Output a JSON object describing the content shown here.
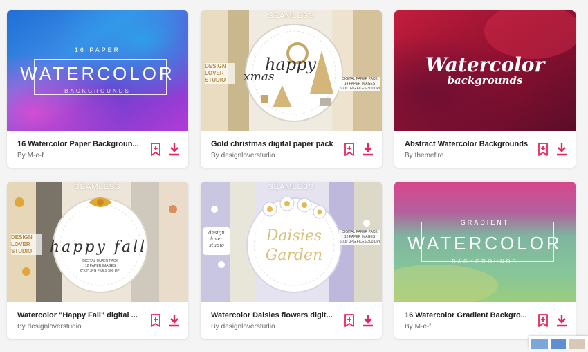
{
  "cards": [
    {
      "title": "16 Watercolor Paper Backgroun...",
      "by": "By",
      "author": "M-e-f",
      "thumb_top": "16 PAPER",
      "thumb_main": "WATERCOLOR",
      "thumb_bottom": "BACKGROUNDS"
    },
    {
      "title": "Gold christmas digital paper pack",
      "by": "By",
      "author": "designloverstudio",
      "thumb_top": "SEAMLESS",
      "thumb_main": "happy",
      "thumb_main2": "xmas",
      "thumb_brand": "DESIGN LOVER STUDIO",
      "thumb_pack": "DIGITAL PAPER PACK",
      "thumb_pack2": "14 PAPER IMAGES",
      "thumb_pack3": "6\"X6\" JPG FILES 300 DPI"
    },
    {
      "title": "Abstract Watercolor Backgrounds",
      "by": "By",
      "author": "themefire",
      "thumb_main": "Watercolor",
      "thumb_sub": "backgrounds"
    },
    {
      "title": "Watercolor \"Happy Fall\" digital ...",
      "by": "By",
      "author": "designloverstudio",
      "thumb_top": "SEAMLESS",
      "thumb_main": "happy fall",
      "thumb_brand": "DESIGN LOVER STUDIO",
      "thumb_pack": "DIGITAL PAPER PACK",
      "thumb_pack2": "12 PAPER IMAGES",
      "thumb_pack3": "6\"X6\" JPG FILES 300 DPI"
    },
    {
      "title": "Watercolor Daisies flowers digit...",
      "by": "By",
      "author": "designloverstudio",
      "thumb_top": "SEAMLESS",
      "thumb_main": "Daisies",
      "thumb_main2": "Garden",
      "thumb_brand": "design lover studio",
      "thumb_pack": "DIGITAL PAPER PACK",
      "thumb_pack2": "12 PAPER IMAGES",
      "thumb_pack3": "6\"X6\" JPG FILES 300 DPI"
    },
    {
      "title": "16 Watercolor Gradient Backgro...",
      "by": "By",
      "author": "M-e-f",
      "thumb_top": "GRADIENT",
      "thumb_main": "WATERCOLOR",
      "thumb_bottom": "BACKGROUNDS"
    }
  ],
  "icons": {
    "bookmark": "bookmark-add-icon",
    "download": "download-icon"
  },
  "colors": {
    "accent": "#e8265b",
    "card_bg": "#ffffff",
    "page_bg": "#f4f4f4"
  }
}
